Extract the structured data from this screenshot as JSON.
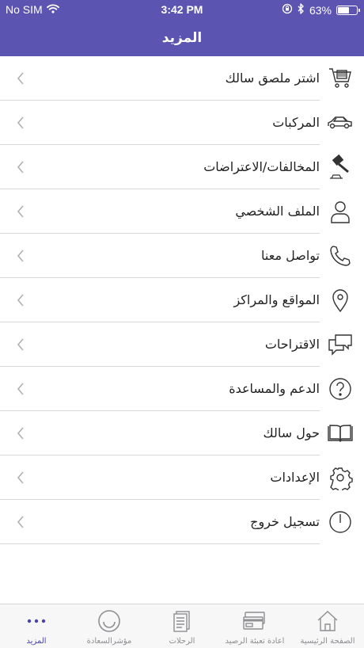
{
  "status_bar": {
    "carrier": "No SIM",
    "time": "3:42 PM",
    "battery_percent": "63%",
    "battery_level": 0.63
  },
  "header": {
    "title": "المزيد"
  },
  "menu": {
    "items": [
      {
        "label": "اشتر ملصق سالك",
        "icon": "shopping-cart-icon"
      },
      {
        "label": "المركبات",
        "icon": "car-icon"
      },
      {
        "label": "المخالفات/الاعتراضات",
        "icon": "gavel-icon"
      },
      {
        "label": "الملف الشخصي",
        "icon": "person-icon"
      },
      {
        "label": "تواصل معنا",
        "icon": "phone-icon"
      },
      {
        "label": "المواقع والمراكز",
        "icon": "location-pin-icon"
      },
      {
        "label": "الاقتراحات",
        "icon": "chat-bubbles-icon"
      },
      {
        "label": "الدعم والمساعدة",
        "icon": "question-icon"
      },
      {
        "label": "حول سالك",
        "icon": "book-icon"
      },
      {
        "label": "الإعدادات",
        "icon": "gear-icon"
      },
      {
        "label": "تسجيل خروج",
        "icon": "power-icon"
      }
    ]
  },
  "tabbar": {
    "tabs": [
      {
        "label": "الصفحة الرئيسية",
        "icon": "home-icon",
        "active": false
      },
      {
        "label": "اعادة تعبئة الرصيد",
        "icon": "cards-icon",
        "active": false
      },
      {
        "label": "الرحلات",
        "icon": "document-icon",
        "active": false
      },
      {
        "label": "مؤشرالسعادة",
        "icon": "smiley-icon",
        "active": false
      },
      {
        "label": "المزيد",
        "icon": "more-dots-icon",
        "active": true
      }
    ]
  },
  "colors": {
    "header_bg": "#5b54b0",
    "active_tab": "#4b43a8",
    "inactive_tab": "#8e8e93",
    "icon_stroke": "#333333",
    "chevron": "#b0b0b0"
  }
}
